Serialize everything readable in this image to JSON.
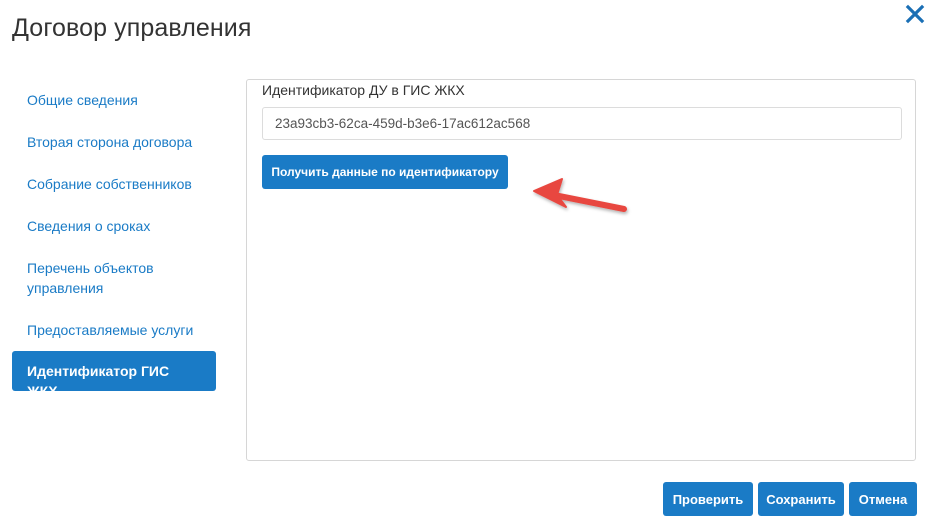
{
  "dialog": {
    "title": "Договор управления",
    "close_icon": "close-icon"
  },
  "sidebar": {
    "items": [
      {
        "label": "Общие сведения",
        "active": false
      },
      {
        "label": "Вторая сторона договора",
        "active": false
      },
      {
        "label": "Собрание собственников",
        "active": false
      },
      {
        "label": "Сведения о сроках",
        "active": false
      },
      {
        "label": "Перечень объектов управления",
        "active": false
      },
      {
        "label": "Предоставляемые услуги",
        "active": false
      },
      {
        "label": "Идентификатор ГИС ЖКХ",
        "active": true
      }
    ]
  },
  "main": {
    "field_label": "Идентификатор ДУ в ГИС ЖКХ",
    "field_value": "23a93cb3-62ca-459d-b3e6-17ac612ac568",
    "fetch_button": "Получить данные по идентификатору",
    "annotation_icon": "red-arrow-icon"
  },
  "footer": {
    "check_button": "Проверить",
    "save_button": "Сохранить",
    "cancel_button": "Отмена"
  },
  "colors": {
    "accent": "#1a7bc6",
    "annotation": "#e8473f"
  }
}
